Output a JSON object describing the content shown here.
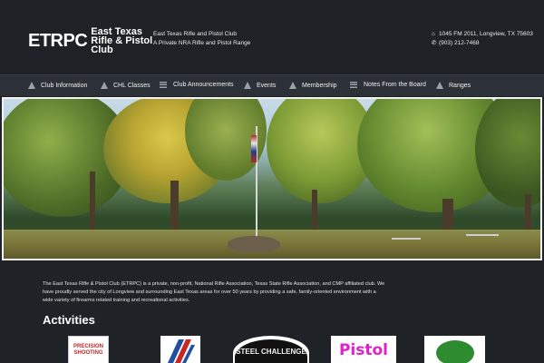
{
  "header": {
    "logo_abbr": "ETRPC",
    "logo_name": "East Texas Rifle & Pistol Club",
    "tagline_line1": "East Texas Rifle and Pistol Club",
    "tagline_line2": "A Private NRA Rifle and Pistol Range",
    "address": "1045 FM 2011, Longview, TX 75603",
    "phone": "(903) 212-7468"
  },
  "nav": {
    "items": [
      {
        "label": "Club Information",
        "icon": "triangle-icon"
      },
      {
        "label": "CHL Classes",
        "icon": "triangle-icon"
      },
      {
        "label": "Club Announcements",
        "icon": "menu-icon"
      },
      {
        "label": "Events",
        "icon": "triangle-icon"
      },
      {
        "label": "Membership",
        "icon": "triangle-icon"
      },
      {
        "label": "Notes From the Board",
        "icon": "menu-icon"
      },
      {
        "label": "Ranges",
        "icon": "triangle-icon"
      }
    ]
  },
  "about": {
    "text": "The East Texas Rifle & Pistol Club (ETRPC) is a private, non-profit, National Rifle Association, Texas State Rifle Association, and CMP affiliated club. We have proudly served the city of Longview and surrounding East Texas areas for over 50 years by providing a safe, family-oriented environment with a wide variety of firearms related training and recreational activities."
  },
  "activities": {
    "title": "Activities",
    "items": [
      {
        "label": "PRECISION SHOOTING"
      },
      {
        "label": ""
      },
      {
        "label": "STEEL CHALLENGE"
      },
      {
        "label": "Pistol"
      },
      {
        "label": ""
      }
    ]
  },
  "colors": {
    "background": "#1f2328",
    "nav": "#2c3137",
    "accent_pink": "#e020c8"
  }
}
